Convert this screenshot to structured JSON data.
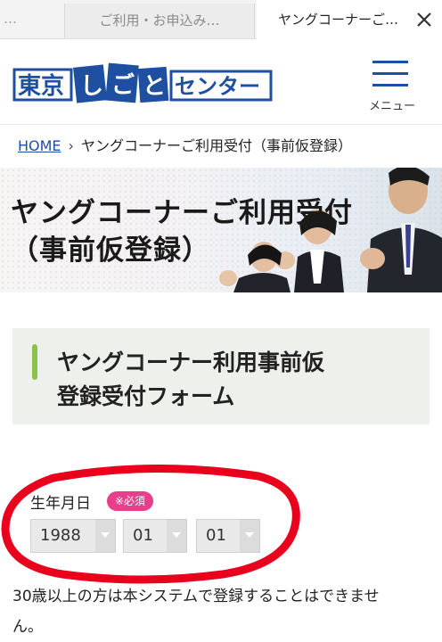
{
  "browser": {
    "left_tab_fragment": "…",
    "prev_tab_label": "ご利用・お申込み…",
    "active_tab_label": "ヤングコーナーご…",
    "close_icon": "close-icon"
  },
  "header": {
    "logo_text": "東京しごとセンター",
    "menu_label": "メニュー",
    "brand_color": "#1e4fa0"
  },
  "breadcrumb": {
    "home": "HOME",
    "separator": "›",
    "current": "ヤングコーナーご利用受付（事前仮登録）"
  },
  "hero": {
    "title_line1": "ヤングコーナーご利用受付",
    "title_line2": "（事前仮登録）"
  },
  "form": {
    "title_line1": "ヤングコーナー利用事前仮",
    "title_line2": "登録受付フォーム",
    "accent_color": "#8bc34a",
    "dob": {
      "label": "生年月日",
      "required_badge": "※必須",
      "year": "1988",
      "month": "01",
      "day": "01"
    },
    "notice_line1": "30歳以上の方は本システムで登録することはできませ",
    "notice_line2": "ん。"
  },
  "annotation_color": "#e8001c"
}
